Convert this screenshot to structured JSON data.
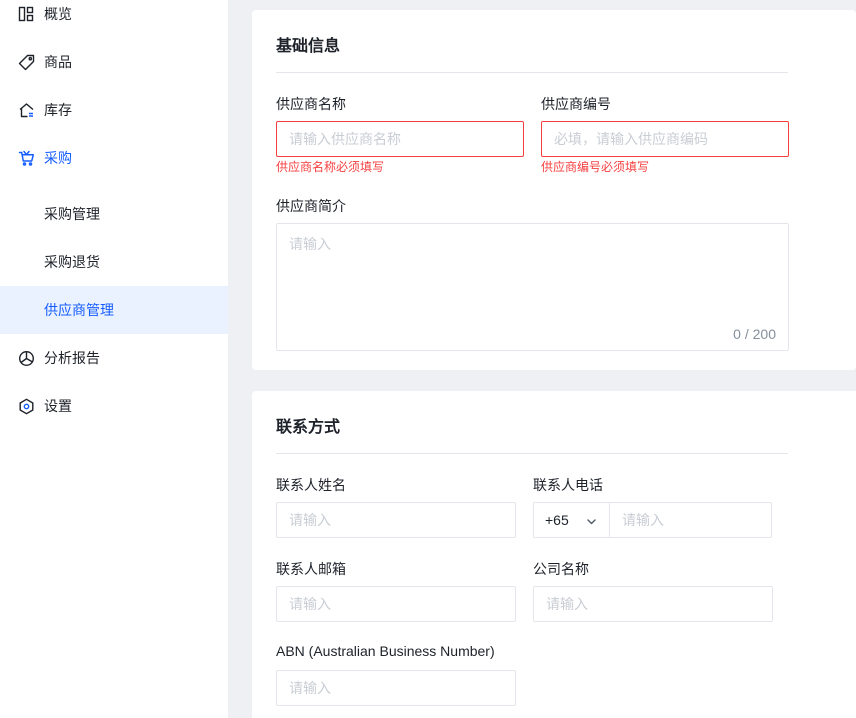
{
  "sidebar": {
    "items": [
      {
        "label": "概览",
        "icon": "dashboard-icon"
      },
      {
        "label": "商品",
        "icon": "tag-icon"
      },
      {
        "label": "库存",
        "icon": "warehouse-icon"
      },
      {
        "label": "采购",
        "icon": "cart-icon"
      },
      {
        "label": "分析报告",
        "icon": "pie-chart-icon"
      },
      {
        "label": "设置",
        "icon": "settings-icon"
      }
    ],
    "sub_items": [
      {
        "label": "采购管理"
      },
      {
        "label": "采购退货"
      },
      {
        "label": "供应商管理"
      }
    ],
    "active_color": "#165dff"
  },
  "basic": {
    "title": "基础信息",
    "supplier_name": {
      "label": "供应商名称",
      "placeholder": "请输入供应商名称",
      "error": "供应商名称必须填写"
    },
    "supplier_code": {
      "label": "供应商编号",
      "placeholder": "必填，请输入供应商编码",
      "error": "供应商编号必须填写"
    },
    "intro": {
      "label": "供应商简介",
      "placeholder": "请输入",
      "count": "0 / 200"
    }
  },
  "contact": {
    "title": "联系方式",
    "name": {
      "label": "联系人姓名",
      "placeholder": "请输入"
    },
    "phone": {
      "label": "联系人电话",
      "code": "+65",
      "placeholder": "请输入"
    },
    "email": {
      "label": "联系人邮箱",
      "placeholder": "请输入"
    },
    "company": {
      "label": "公司名称",
      "placeholder": "请输入"
    },
    "abn": {
      "label": "ABN (Australian Business Number)",
      "placeholder": "请输入"
    }
  }
}
